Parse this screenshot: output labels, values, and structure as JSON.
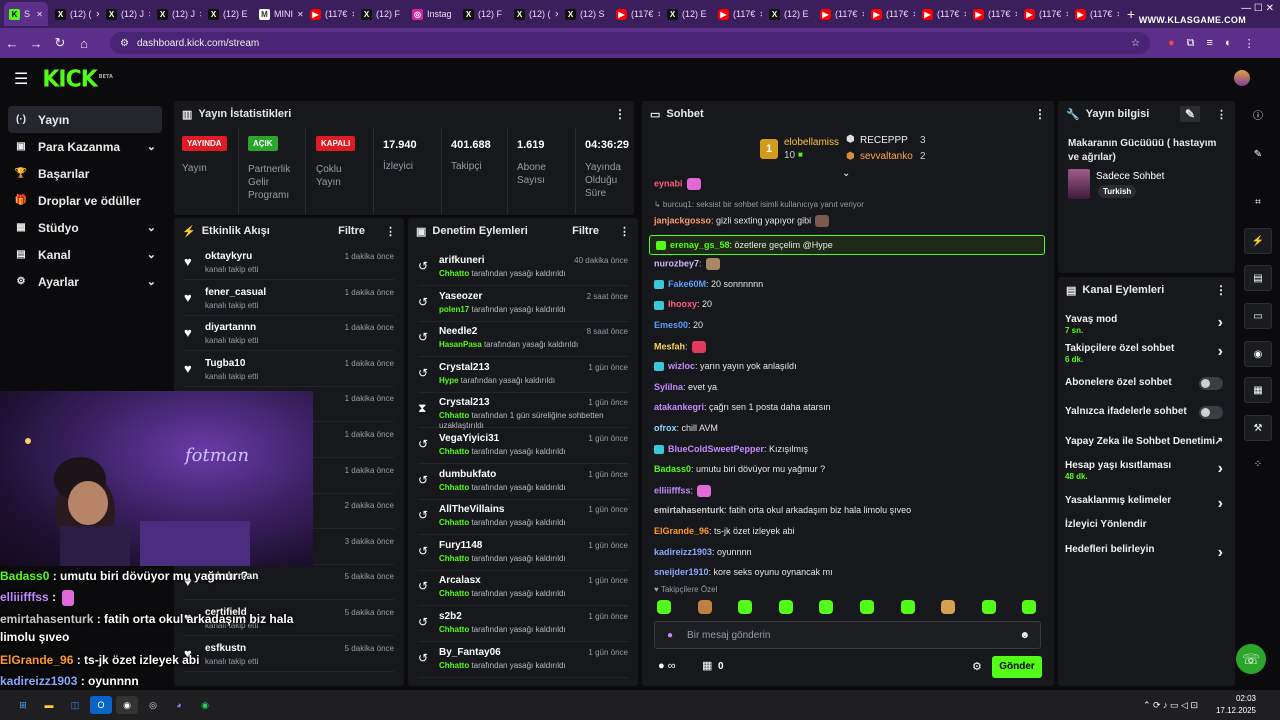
{
  "browser": {
    "tabs": [
      {
        "label": "S",
        "icon": "kick"
      },
      {
        "label": "(12) (",
        "icon": "x"
      },
      {
        "label": "(12) J",
        "icon": "x"
      },
      {
        "label": "(12) J",
        "icon": "x"
      },
      {
        "label": "(12) E",
        "icon": "x"
      },
      {
        "label": "MINI",
        "icon": "mini"
      },
      {
        "label": "(117€",
        "icon": "youtube"
      },
      {
        "label": "(12) F",
        "icon": "x"
      },
      {
        "label": "Instag",
        "icon": "instagram"
      },
      {
        "label": "(12) F",
        "icon": "x"
      },
      {
        "label": "(12) (",
        "icon": "x"
      },
      {
        "label": "(12) S",
        "icon": "x"
      },
      {
        "label": "(117€",
        "icon": "youtube"
      },
      {
        "label": "(12) E",
        "icon": "x"
      },
      {
        "label": "(117€",
        "icon": "youtube"
      },
      {
        "label": "(12) E",
        "icon": "x"
      },
      {
        "label": "(117€",
        "icon": "youtube"
      },
      {
        "label": "(117€",
        "icon": "youtube"
      },
      {
        "label": "(117€",
        "icon": "youtube"
      },
      {
        "label": "(117€",
        "icon": "youtube"
      },
      {
        "label": "(117€",
        "icon": "youtube"
      },
      {
        "label": "(117€",
        "icon": "youtube"
      }
    ],
    "new_tab": "+",
    "watermark": "WWW.KLASGAME.COM",
    "url": "dashboard.kick.com/stream"
  },
  "header": {
    "logo": "KICK",
    "logo_badge": "BETA"
  },
  "sidebar": {
    "items": [
      {
        "label": "Yayın",
        "icon": "(·)",
        "active": true
      },
      {
        "label": "Para Kazanma",
        "icon": "▣",
        "chevron": true
      },
      {
        "label": "Başarılar",
        "icon": "🏆"
      },
      {
        "label": "Droplar ve ödüller",
        "icon": "🎁"
      },
      {
        "label": "Stüdyo",
        "icon": "▦",
        "chevron": true
      },
      {
        "label": "Kanal",
        "icon": "▤",
        "chevron": true
      },
      {
        "label": "Ayarlar",
        "icon": "⚙",
        "chevron": true
      }
    ]
  },
  "stats": {
    "title": "Yayın İstatistikleri",
    "live_badge": "YAYINDA",
    "live_label": "Yayın",
    "partner_badge": "AÇIK",
    "partner_label": "Partnerlik Gelir Programı",
    "multi_badge": "KAPALI",
    "multi_label": "Çoklu Yayın",
    "viewers_value": "17.940",
    "viewers_label": "İzleyici",
    "followers_value": "401.688",
    "followers_label": "Takipçi",
    "subs_value": "1.619",
    "subs_label": "Abone Sayısı",
    "uptime_value": "04:36:29",
    "uptime_label": "Yayında Olduğu Süre"
  },
  "activity": {
    "title": "Etkinlik Akışı",
    "filter": "Filtre",
    "rows": [
      {
        "name": "oktaykyru",
        "action": "kanalı takip etti",
        "time": "1 dakika önce"
      },
      {
        "name": "fener_casual",
        "action": "kanalı takip etti",
        "time": "1 dakika önce"
      },
      {
        "name": "diyartannn",
        "action": "kanalı takip etti",
        "time": "1 dakika önce"
      },
      {
        "name": "Tugba10",
        "action": "kanalı takip etti",
        "time": "1 dakika önce"
      },
      {
        "name": "",
        "action": "",
        "time": "1 dakika önce"
      },
      {
        "name": "",
        "action": "",
        "time": "1 dakika önce"
      },
      {
        "name": "",
        "action": "",
        "time": "1 dakika önce"
      },
      {
        "name": "",
        "action": "",
        "time": "2 dakika önce"
      },
      {
        "name": "",
        "action": "",
        "time": "3 dakika önce"
      },
      {
        "name": "sokahrman",
        "action": "",
        "time": "5 dakika önce"
      },
      {
        "name": "certifield",
        "action": "kanalı takip etti",
        "time": "5 dakika önce"
      },
      {
        "name": "esfkustn",
        "action": "kanalı takip etti",
        "time": "5 dakika önce"
      }
    ]
  },
  "moderation": {
    "title": "Denetim Eylemleri",
    "filter": "Filtre",
    "rows": [
      {
        "name": "arifkuneri",
        "by": "Chhatto",
        "rest": "tarafından yasağı kaldırıldı",
        "time": "40 dakika önce",
        "icon": "unban"
      },
      {
        "name": "Yaseozer",
        "by": "polen17",
        "rest": "tarafından yasağı kaldırıldı",
        "time": "2 saat önce",
        "icon": "unban"
      },
      {
        "name": "Needle2",
        "by": "HasanPasa",
        "rest": "tarafından yasağı kaldırıldı",
        "time": "8 saat önce",
        "icon": "unban"
      },
      {
        "name": "Crystal213",
        "by": "Hype",
        "rest": "tarafından yasağı kaldırıldı",
        "time": "1 gün önce",
        "icon": "unban"
      },
      {
        "name": "Crystal213",
        "by": "Chhatto",
        "rest": "tarafından 1 gün süreliğine sohbetten uzaklaştırıldı",
        "time": "1 gün önce",
        "icon": "timeout"
      },
      {
        "name": "VegaYiyici31",
        "by": "Chhatto",
        "rest": "tarafından yasağı kaldırıldı",
        "time": "1 gün önce",
        "icon": "unban"
      },
      {
        "name": "dumbukfato",
        "by": "Chhatto",
        "rest": "tarafından yasağı kaldırıldı",
        "time": "1 gün önce",
        "icon": "unban"
      },
      {
        "name": "AllTheVillains",
        "by": "Chhatto",
        "rest": "tarafından yasağı kaldırıldı",
        "time": "1 gün önce",
        "icon": "unban"
      },
      {
        "name": "Fury1148",
        "by": "Chhatto",
        "rest": "tarafından yasağı kaldırıldı",
        "time": "1 gün önce",
        "icon": "unban"
      },
      {
        "name": "Arcalasx",
        "by": "Chhatto",
        "rest": "tarafından yasağı kaldırıldı",
        "time": "1 gün önce",
        "icon": "unban"
      },
      {
        "name": "s2b2",
        "by": "Chhatto",
        "rest": "tarafından yasağı kaldırıldı",
        "time": "1 gün önce",
        "icon": "unban"
      },
      {
        "name": "By_Fantay06",
        "by": "Chhatto",
        "rest": "tarafından yasağı kaldırıldı",
        "time": "1 gün önce",
        "icon": "unban"
      }
    ]
  },
  "chat": {
    "title": "Sohbet",
    "leader1": {
      "name": "elobellamiss",
      "count": "10",
      "rank": "1"
    },
    "leader2": {
      "name": "RECEPPP",
      "count": "3"
    },
    "leader3": {
      "name": "sevvaltanko",
      "count": "2"
    },
    "messages": [
      {
        "user": "eynabi",
        "text": "",
        "color": "#ff5a7a"
      },
      {
        "user": "",
        "text": "↳ burcuq1: seksist bir sohbet isimli kullanıcıya yanıt veriyor",
        "color": "#9a9ca3",
        "reply": true
      },
      {
        "user": "janjackgosso",
        "text": ": gizli sexting yapıyor gibi",
        "color": "#ff9a6a"
      },
      {
        "user": "erenay_gs_58",
        "text": ": özetlere geçelim @Hype",
        "color": "#53fc18",
        "highlight": true
      },
      {
        "user": "nurozbey7",
        "text": ":",
        "color": "#d0b5ff"
      },
      {
        "user": "Fake60M",
        "text": ": 20 sonnnnnn",
        "color": "#5aa0ff"
      },
      {
        "user": "Ihooxy",
        "text": ": 20",
        "color": "#ff5a7a"
      },
      {
        "user": "Emes00",
        "text": ": 20",
        "color": "#5aa0ff"
      },
      {
        "user": "Mesfah",
        "text": ":",
        "color": "#ffd25a"
      },
      {
        "user": "wizloc",
        "text": ": yarın yayın yok anlaşıldı",
        "color": "#c58aff"
      },
      {
        "user": "Sylilna",
        "text": ": evet ya",
        "color": "#c58aff"
      },
      {
        "user": "atakankegri",
        "text": ": çağrı sen 1 posta daha atarsın",
        "color": "#c58aff"
      },
      {
        "user": "ofrox",
        "text": ": chill AVM",
        "color": "#8ad8ff"
      },
      {
        "user": "BlueColdSweetPepper",
        "text": ": Kızışılmış",
        "color": "#c58aff"
      },
      {
        "user": "Badass0",
        "text": ": umutu biri dövüyor mu yağmur ?",
        "color": "#53fc18"
      },
      {
        "user": "elliiifffss",
        "text": ":",
        "color": "#c58aff"
      },
      {
        "user": "emirtahasenturk",
        "text": ": fatih orta okul arkadaşım biz hala limolu şıveo",
        "color": "#c8c8c8"
      },
      {
        "user": "ElGrande_96",
        "text": ": ts-jk özet izleyek abi",
        "color": "#ff9a2a"
      },
      {
        "user": "kadireizz1903",
        "text": ": oyunnnn",
        "color": "#8aa8ff"
      },
      {
        "user": "sneijder1910",
        "text": ": kore seks oyunu oynancak mı",
        "color": "#8aa8ff"
      }
    ],
    "followers_only": "Takipçilere Özel",
    "input_placeholder": "Bir mesaj gönderin",
    "points": "0",
    "send": "Gönder"
  },
  "info": {
    "title": "Yayın bilgisi",
    "stream_title": "Makaranın Gücüüüü ( hastayım ve ağrılar)",
    "category": "Sadece Sohbet",
    "tag": "Turkish"
  },
  "channel_actions": {
    "title": "Kanal Eylemleri",
    "items": [
      {
        "label": "Yavaş mod",
        "sub": "7 sn.",
        "kind": "arrow"
      },
      {
        "label": "Takipçilere özel sohbet",
        "sub": "6 dk.",
        "kind": "arrow"
      },
      {
        "label": "Abonelere özel sohbet",
        "sub": "",
        "kind": "toggle"
      },
      {
        "label": "Yalnızca ifadelerle sohbet",
        "sub": "",
        "kind": "toggle"
      },
      {
        "label": "Yapay Zeka ile Sohbet Denetimi",
        "sub": "",
        "kind": "external"
      },
      {
        "label": "Hesap yaşı kısıtlaması",
        "sub": "48 dk.",
        "kind": "arrow"
      },
      {
        "label": "Yasaklanmış kelimeler",
        "sub": "",
        "kind": "arrow"
      },
      {
        "label": "İzleyici Yönlendir",
        "sub": "",
        "kind": "none"
      },
      {
        "label": "Hedefleri belirleyin",
        "sub": "",
        "kind": "arrow"
      }
    ]
  },
  "overlay": {
    "lines": [
      {
        "user": "Badass0",
        "text": " : umutu biri dövüyor mu yağmur ?",
        "color": "#53fc18"
      },
      {
        "user": "elliiifffss",
        "text": " :",
        "color": "#c58aff"
      },
      {
        "user": "emirtahasenturk",
        "text": " : fatih orta okul arkadaşım biz hala limolu şıveo",
        "color": "#c8c8c8"
      },
      {
        "user": "ElGrande_96",
        "text": " : ts-jk özet izleyek abi",
        "color": "#ff9a2a"
      },
      {
        "user": "kadireizz1903",
        "text": " : oyunnnn",
        "color": "#8aa8ff"
      }
    ]
  },
  "taskbar": {
    "time": "02:03",
    "date": "17.12.2025"
  },
  "colors": {
    "accent": "#53fc18",
    "live": "#e01b24",
    "partner": "#2ca52c",
    "browser": "#5b2f8a"
  }
}
